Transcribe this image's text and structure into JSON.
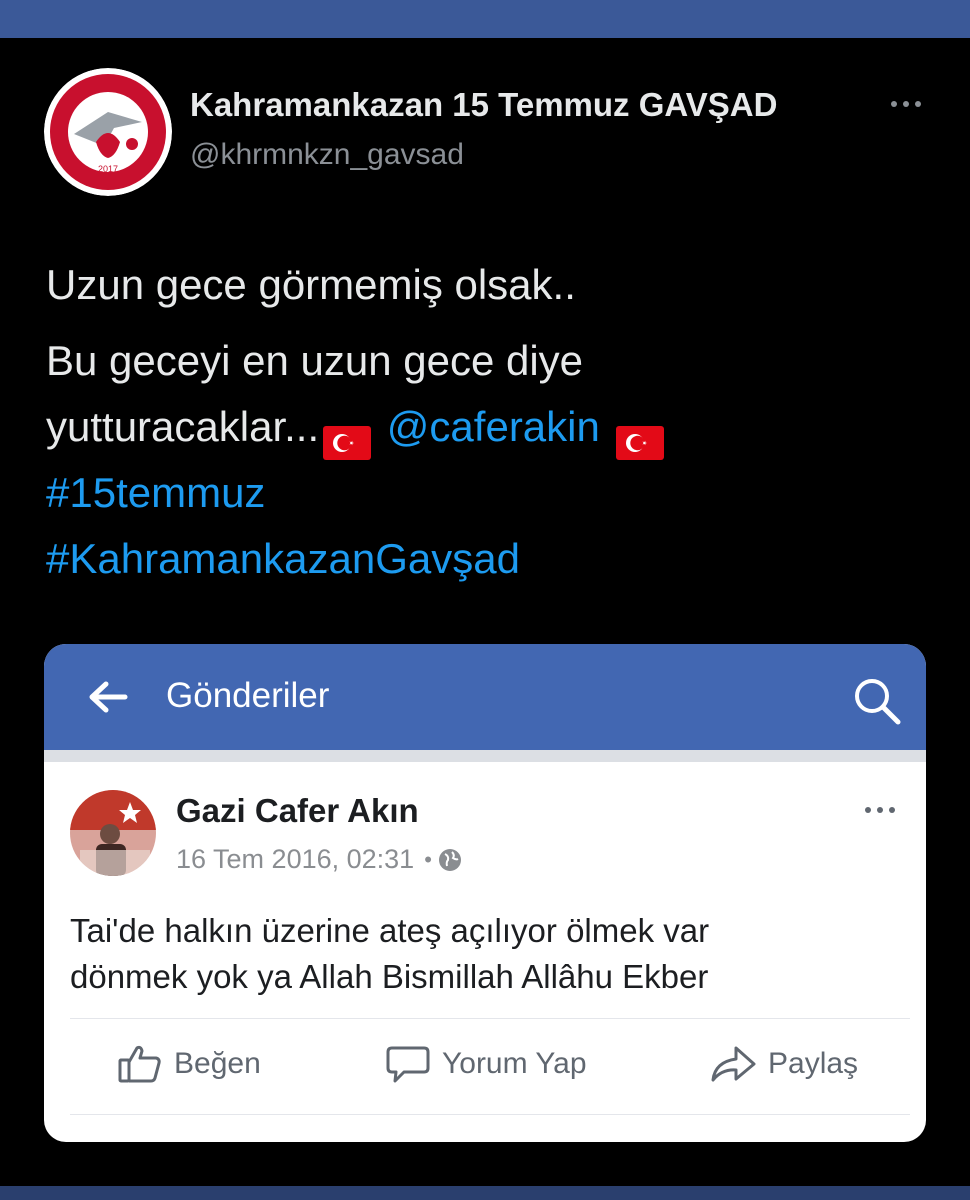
{
  "tweet": {
    "display_name": "Kahramankazan 15 Temmuz GAVŞAD",
    "handle": "@khrmnkzn_gavsad",
    "avatar": {
      "ring_text": "KAHRAMANKAZAN 15 TEMMUZ GAZİLER VE ŞEHİT AİLELERİ DERNEĞİ",
      "year": "2017"
    },
    "line1": "Uzun gece görmemiş olsak..",
    "line2a": "Bu geceyi en uzun gece diye",
    "line2b": "yutturacaklar...",
    "mention": "@caferakin",
    "hashtag1": "#15temmuz",
    "hashtag2": "#KahramankazanGavşad",
    "flag_icon": "turkish-flag"
  },
  "embedded_post": {
    "header_title": "Gönderiler",
    "author": "Gazi Cafer Akın",
    "timestamp": "16 Tem 2016, 02:31",
    "meta_dot": "•",
    "text_line1": "Tai'de  halkın üzerine ateş açılıyor ölmek var",
    "text_line2": "dönmek  yok  ya Allah  Bismillah  Allâhu Ekber",
    "actions": {
      "like": "Beğen",
      "comment": "Yorum Yap",
      "share": "Paylaş"
    }
  },
  "colors": {
    "background": "#000000",
    "link": "#1d9bf0",
    "fb_blue": "#4267b2",
    "top_bar": "#3b5998"
  }
}
